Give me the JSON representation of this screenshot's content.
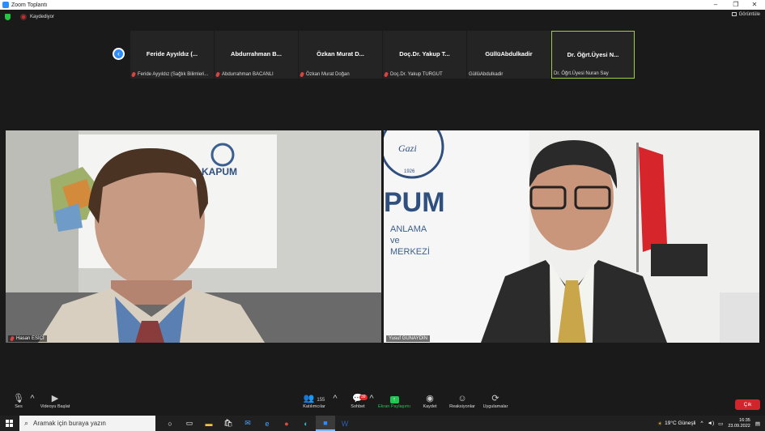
{
  "window": {
    "title": "Zoom Toplantı",
    "controls": [
      "–",
      "❐",
      "✕"
    ]
  },
  "topbar": {
    "recording_label": "Kaydediyor",
    "view_label": "Görüntüle"
  },
  "gallery": {
    "participants": [
      {
        "display": "Feride Ayyıldız (...",
        "label": "Feride Ayyıldız (Sağlık Bilimleri...",
        "muted": true,
        "active": false
      },
      {
        "display": "Abdurrahman B...",
        "label": "Abdurrahman BACANLI",
        "muted": true,
        "active": false
      },
      {
        "display": "Özkan Murat D...",
        "label": "Özkan Murat Doğan",
        "muted": true,
        "active": false
      },
      {
        "display": "Doç.Dr. Yakup T...",
        "label": "Doç.Dr. Yakup TURGUT",
        "muted": true,
        "active": false
      },
      {
        "display": "GüllüAbdulkadir",
        "label": "GüllüAbdulkadir",
        "muted": false,
        "active": false
      },
      {
        "display": "Dr. Öğrt.Üyesi N...",
        "label": "Dr. Öğrt.Üyesi Nuran Say",
        "muted": false,
        "active": true
      }
    ]
  },
  "videos": {
    "left": {
      "name": "Hasan ESİCİ",
      "banner_text": "KAPUM"
    },
    "right": {
      "name": "Yusuf GÜNAYDIN",
      "banner_text": "PUM",
      "banner_sub": [
        "ANLAMA",
        "ve",
        "MERKEZİ"
      ],
      "logo_text": "Gazi",
      "logo_year": "1926"
    }
  },
  "toolbar": {
    "audio": "Ses",
    "video": "Videoyu Başlat",
    "participants": "Katılımcılar",
    "participants_count": "155",
    "chat": "Sohbet",
    "chat_badge": "39",
    "share": "Ekran Paylaşımı",
    "record": "Kaydet",
    "reactions": "Reaksiyonlar",
    "apps": "Uygulamalar",
    "leave": "Çık"
  },
  "taskbar": {
    "search_placeholder": "Aramak için buraya yazın",
    "weather": "19°C  Güneşli",
    "time": "16:35",
    "date": "23.09.2022"
  }
}
